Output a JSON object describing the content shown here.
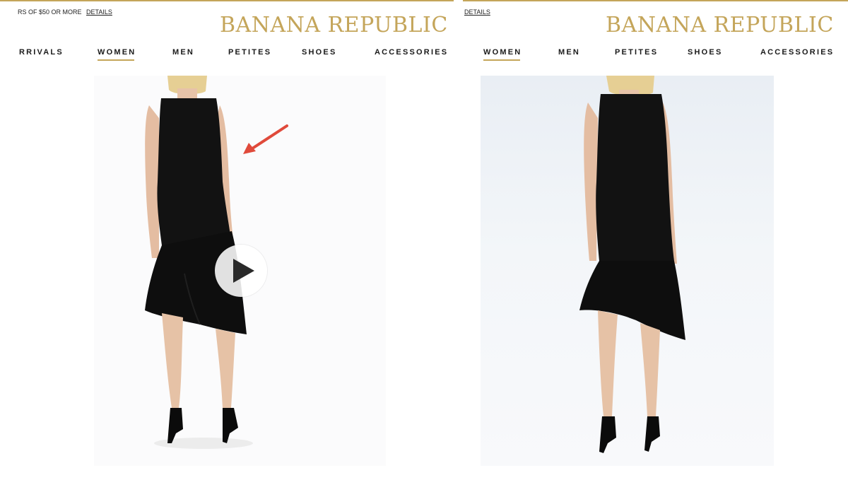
{
  "left_panel": {
    "promo_text": "RS OF $50 OR MORE",
    "details_label": "DETAILS",
    "logo": "BANANA REPUBLIC",
    "nav": [
      "RRIVALS",
      "WOMEN",
      "MEN",
      "PETITES",
      "SHOES",
      "ACCESSORIES"
    ],
    "active_nav": "WOMEN",
    "media": {
      "type": "video",
      "play_icon": "play-icon",
      "annotation": "red-arrow-icon"
    }
  },
  "right_panel": {
    "details_label": "DETAILS",
    "logo": "BANANA REPUBLIC",
    "nav": [
      "WOMEN",
      "MEN",
      "PETITES",
      "SHOES",
      "ACCESSORIES"
    ],
    "active_nav": "WOMEN",
    "media": {
      "type": "photo"
    }
  },
  "colors": {
    "brand_gold": "#c4a55a",
    "annotation_red": "#e04a3b",
    "dress": "#111111"
  }
}
